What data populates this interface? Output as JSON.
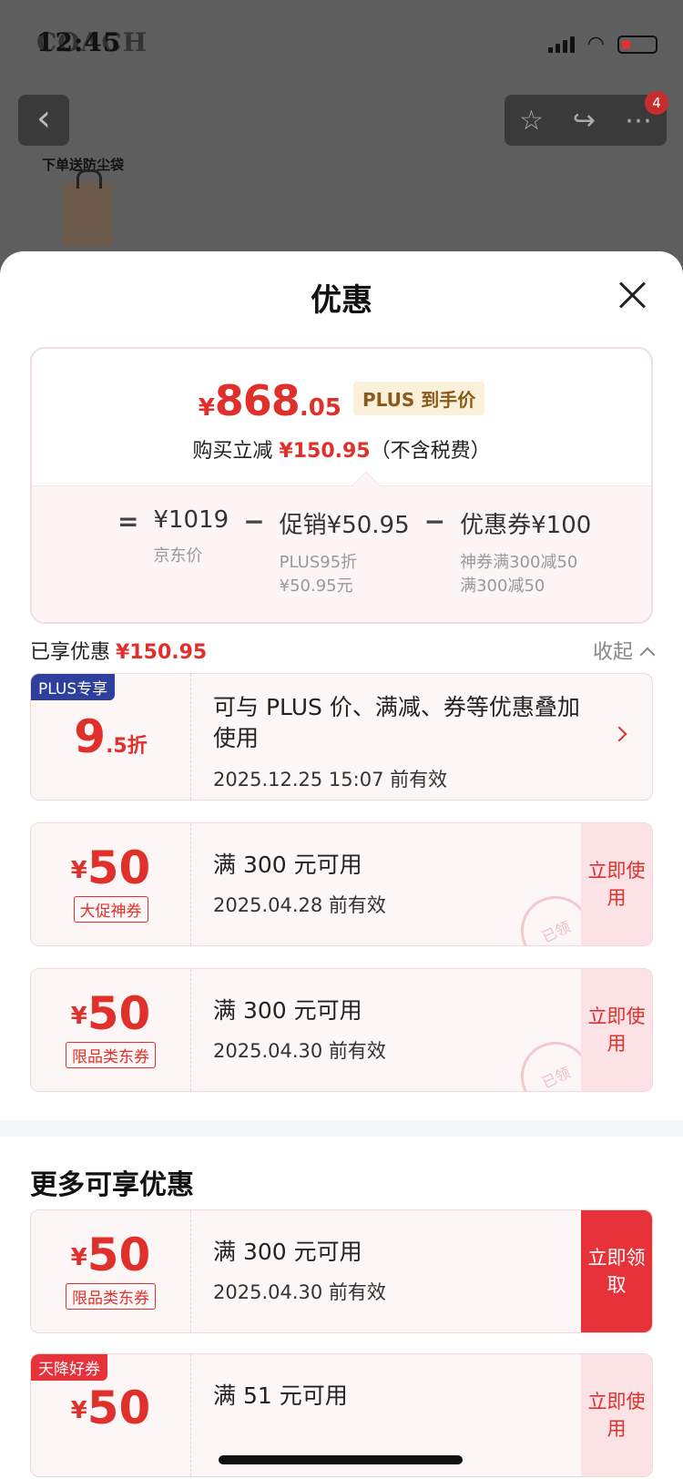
{
  "status_bar": {
    "time": "12:45",
    "brand_text": "COACH"
  },
  "product_bg": {
    "bag_label": "下单送防尘袋",
    "cart_badge": "4"
  },
  "sheet": {
    "title": "优惠",
    "price_card": {
      "currency": "¥",
      "final_int": "868",
      "final_dec": ".05",
      "plus_tag": "PLUS 到手价",
      "reduce_prefix": "购买立减",
      "reduce_amount": "¥150.95",
      "reduce_suffix": "（不含税费）",
      "formula": {
        "eq": "=",
        "minus": "−",
        "jd_price": "¥1019",
        "jd_price_label": "京东价",
        "promo": "促销¥50.95",
        "promo_sub1": "PLUS95折",
        "promo_sub2": "¥50.95元",
        "coupon": "优惠券¥100",
        "coupon_sub1": "神券满300减50",
        "coupon_sub2": "满300减50"
      }
    },
    "enjoyed": {
      "label": "已享优惠",
      "amount": "¥150.95",
      "collapse": "收起"
    },
    "coupons": [
      {
        "tag": "PLUS专享",
        "discount_int": "9",
        "discount_dec": ".5折",
        "desc": "可与 PLUS 价、满减、券等优惠叠加使用",
        "date": "2025.12.25 15:07 前有效"
      },
      {
        "currency": "¥",
        "amount": "50",
        "type": "大促神券",
        "cond": "满 300 元可用",
        "date": "2025.04.28 前有效",
        "action": "立即使用",
        "stamp": "已领"
      },
      {
        "currency": "¥",
        "amount": "50",
        "type": "限品类东券",
        "cond": "满 300 元可用",
        "date": "2025.04.30 前有效",
        "action": "立即使用",
        "stamp": "已领"
      }
    ],
    "more_title": "更多可享优惠",
    "more_coupons": [
      {
        "currency": "¥",
        "amount": "50",
        "type": "限品类东券",
        "cond": "满 300 元可用",
        "date": "2025.04.30 前有效",
        "action": "立即领取"
      },
      {
        "tag": "天降好券",
        "currency": "¥",
        "amount": "50",
        "cond": "满 51 元可用",
        "action": "立即使用"
      }
    ]
  }
}
